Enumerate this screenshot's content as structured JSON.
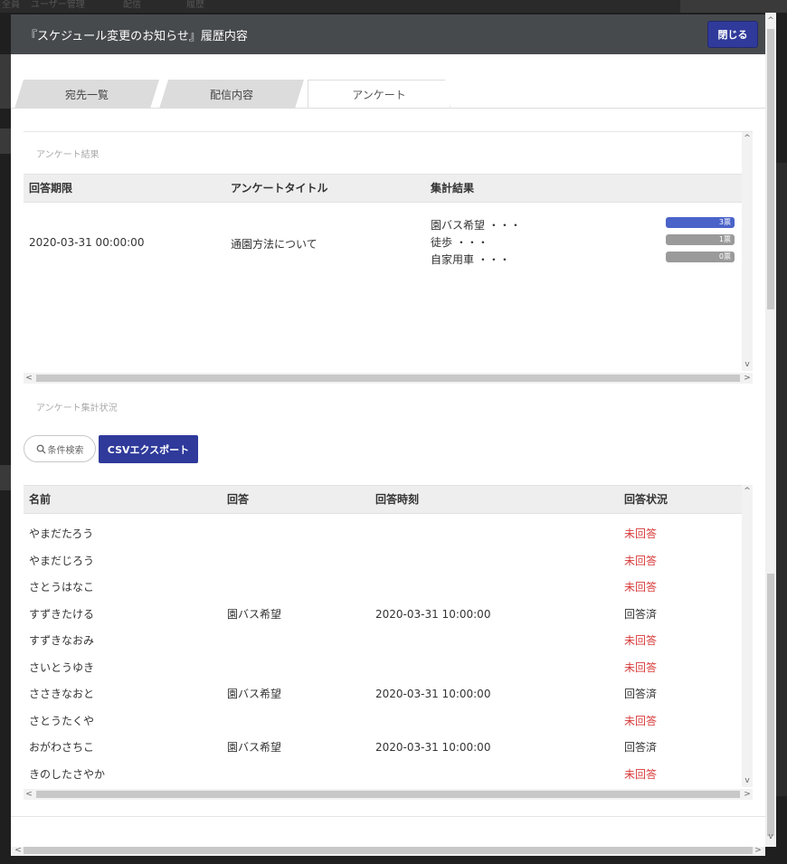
{
  "modal": {
    "title": "『スケジュール変更のお知らせ』履歴内容",
    "close_label": "閉じる"
  },
  "tabs": [
    {
      "label": "宛先一覧",
      "active": false
    },
    {
      "label": "配信内容",
      "active": false
    },
    {
      "label": "アンケート",
      "active": true
    }
  ],
  "results": {
    "section_label": "アンケート結果",
    "headers": {
      "deadline": "回答期限",
      "title": "アンケートタイトル",
      "summary": "集計結果"
    },
    "row": {
      "deadline": "2020-03-31 00:00:00",
      "title": "通園方法について",
      "options": [
        {
          "label": "園バス希望 ・・・",
          "votes": "3票",
          "count": 3,
          "color": "#4a63c9"
        },
        {
          "label": "徒歩 ・・・",
          "votes": "1票",
          "count": 1,
          "color": "#9a9a9a"
        },
        {
          "label": "自家用車 ・・・",
          "votes": "0票",
          "count": 0,
          "color": "#9a9a9a"
        }
      ]
    }
  },
  "status": {
    "section_label": "アンケート集計状況",
    "search_label": "条件検索",
    "csv_label": "CSVエクスポート",
    "headers": {
      "name": "名前",
      "answer": "回答",
      "time": "回答時刻",
      "state": "回答状況"
    },
    "rows": [
      {
        "name": "やまだたろう",
        "answer": "",
        "time": "",
        "state": "未回答",
        "answered": false
      },
      {
        "name": "やまだじろう",
        "answer": "",
        "time": "",
        "state": "未回答",
        "answered": false
      },
      {
        "name": "さとうはなこ",
        "answer": "",
        "time": "",
        "state": "未回答",
        "answered": false
      },
      {
        "name": "すずきたける",
        "answer": "園バス希望",
        "time": "2020-03-31 10:00:00",
        "state": "回答済",
        "answered": true
      },
      {
        "name": "すずきなおみ",
        "answer": "",
        "time": "",
        "state": "未回答",
        "answered": false
      },
      {
        "name": "さいとうゆき",
        "answer": "",
        "time": "",
        "state": "未回答",
        "answered": false
      },
      {
        "name": "ささきなおと",
        "answer": "園バス希望",
        "time": "2020-03-31 10:00:00",
        "state": "回答済",
        "answered": true
      },
      {
        "name": "さとうたくや",
        "answer": "",
        "time": "",
        "state": "未回答",
        "answered": false
      },
      {
        "name": "おがわさちこ",
        "answer": "園バス希望",
        "time": "2020-03-31 10:00:00",
        "state": "回答済",
        "answered": true
      },
      {
        "name": "きのしたさやか",
        "answer": "",
        "time": "",
        "state": "未回答",
        "answered": false
      }
    ]
  },
  "background": {
    "tabs": [
      "全員",
      "ユーザー管理",
      "配信",
      "履歴"
    ]
  },
  "colors": {
    "header_bg": "#474a4d",
    "primary": "#2f3a9b",
    "unanswered": "#d83b3b"
  }
}
